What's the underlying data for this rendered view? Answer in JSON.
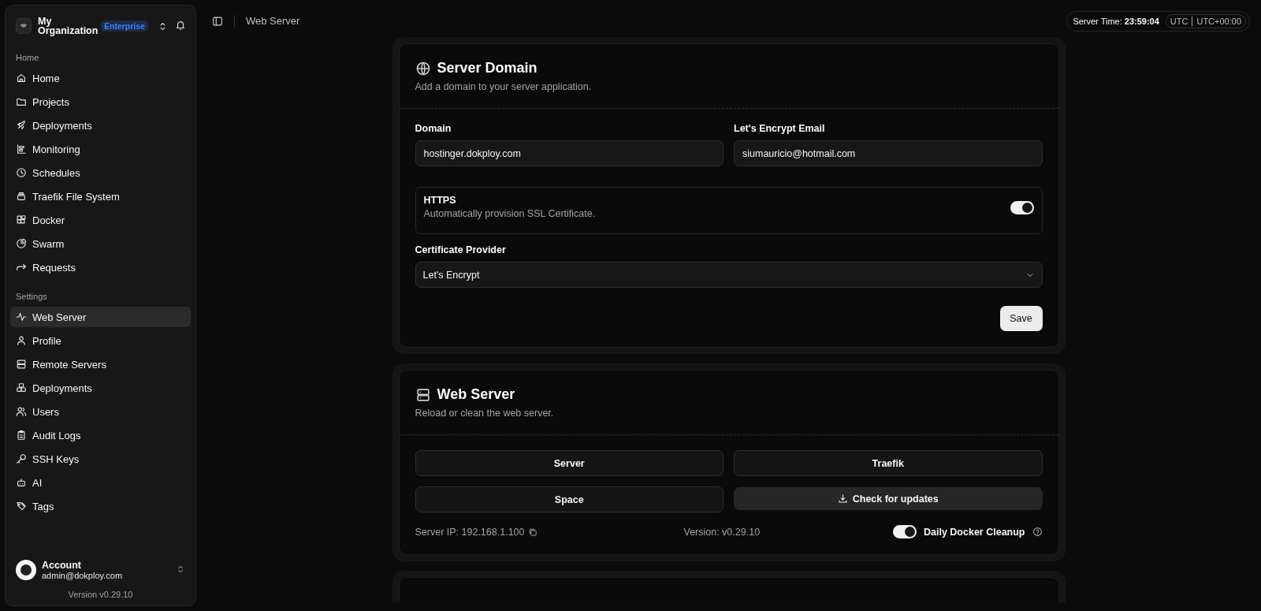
{
  "sidebar": {
    "organization": {
      "name": "My Organization",
      "plan": "Enterprise"
    },
    "groups": [
      {
        "label": "Home",
        "items": [
          {
            "label": "Home",
            "selected": false
          },
          {
            "label": "Projects",
            "selected": false
          },
          {
            "label": "Deployments",
            "selected": false
          },
          {
            "label": "Monitoring",
            "selected": false
          },
          {
            "label": "Schedules",
            "selected": false
          },
          {
            "label": "Traefik File System",
            "selected": false
          },
          {
            "label": "Docker",
            "selected": false
          },
          {
            "label": "Swarm",
            "selected": false
          },
          {
            "label": "Requests",
            "selected": false
          }
        ]
      },
      {
        "label": "Settings",
        "items": [
          {
            "label": "Web Server",
            "selected": true
          },
          {
            "label": "Profile",
            "selected": false
          },
          {
            "label": "Remote Servers",
            "selected": false
          },
          {
            "label": "Deployments",
            "selected": false
          },
          {
            "label": "Users",
            "selected": false
          },
          {
            "label": "Audit Logs",
            "selected": false
          },
          {
            "label": "SSH Keys",
            "selected": false
          },
          {
            "label": "AI",
            "selected": false
          },
          {
            "label": "Tags",
            "selected": false
          }
        ]
      }
    ],
    "account": {
      "name": "Account",
      "email": "admin@dokploy.com"
    },
    "version": "Version v0.29.10"
  },
  "topbar": {
    "breadcrumb": "Web Server",
    "server_time_label": "Server Time:",
    "server_time": "23:59:04",
    "timezone": "UTC",
    "offset": "UTC+00:00"
  },
  "server_domain": {
    "title": "Server Domain",
    "subtitle": "Add a domain to your server application.",
    "domain_label": "Domain",
    "domain_value": "hostinger.dokploy.com",
    "email_label": "Let's Encrypt Email",
    "email_value": "siumauricio@hotmail.com",
    "https": {
      "title": "HTTPS",
      "description": "Automatically provision SSL Certificate.",
      "on": true
    },
    "provider_label": "Certificate Provider",
    "provider_value": "Let's Encrypt",
    "save": "Save"
  },
  "web_server": {
    "title": "Web Server",
    "subtitle": "Reload or clean the web server.",
    "buttons": [
      "Server",
      "Traefik",
      "Space",
      "Check for updates"
    ],
    "server_ip": "Server IP: 192.168.1.100",
    "version": "Version: v0.29.10",
    "cleanup": {
      "label": "Daily Docker Cleanup",
      "on": true
    }
  }
}
